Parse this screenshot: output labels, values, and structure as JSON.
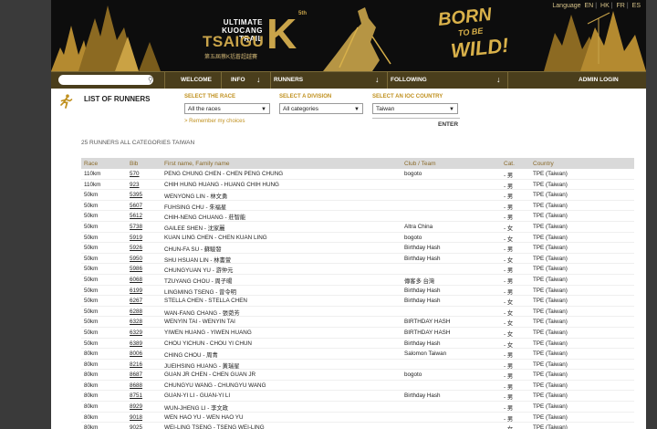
{
  "header": {
    "languages_label": "Language",
    "languages": [
      "EN",
      "HK",
      "FR",
      "ES"
    ],
    "logo_line1": "ULTIMATE",
    "logo_line2": "KUOCANG TRAIL",
    "logo_big": "TSAIGU",
    "logo_k": "K",
    "logo_edition": "5th",
    "logo_sub": "第五屆蔡K括蒼超越賽",
    "slogan": [
      "BORN",
      "TO BE",
      "WILD!"
    ]
  },
  "nav": {
    "search_placeholder": "",
    "items": [
      "WELCOME",
      "INFO",
      "RUNNERS",
      "FOLLOWING",
      "ADMIN LOGIN"
    ]
  },
  "filters": {
    "title": "LIST OF RUNNERS",
    "race_label": "SELECT THE RACE",
    "race_value": "All the races",
    "division_label": "SELECT A DIVISION",
    "division_value": "All categories",
    "country_label": "SELECT AN IOC COUNTRY",
    "country_value": "Taiwan",
    "remember": "> Remember my choices",
    "enter": "ENTER"
  },
  "summary": "25 RUNNERS ALL CATEGORIES TAIWAN",
  "table": {
    "columns": [
      "Race",
      "Bib",
      "First name, Family name",
      "Club / Team",
      "Cat.",
      "Country"
    ],
    "rows": [
      [
        "110km",
        "570",
        "PENG CHUNG CHEN - CHEN PENG CHUNG",
        "bogoto",
        "- 男",
        "TPE (Taiwan)"
      ],
      [
        "110km",
        "923",
        "CHIH HUNG HUANG - HUANG CHIH HUNG",
        "",
        "- 男",
        "TPE (Taiwan)"
      ],
      [
        "50km",
        "5395",
        "WENYONG LIN - 林文勇",
        "",
        "- 男",
        "TPE (Taiwan)"
      ],
      [
        "50km",
        "5607",
        "FUHSING CHU - 朱福星",
        "",
        "- 男",
        "TPE (Taiwan)"
      ],
      [
        "50km",
        "5612",
        "CHIH-NENG CHUANG - 莊智能",
        "",
        "- 男",
        "TPE (Taiwan)"
      ],
      [
        "50km",
        "5738",
        "GAILEE SHEN - 沈家麗",
        "Altra China",
        "- 女",
        "TPE (Taiwan)"
      ],
      [
        "50km",
        "5919",
        "KUAN LING CHEN - CHEN KUAN LING",
        "bogoto",
        "- 女",
        "TPE (Taiwan)"
      ],
      [
        "50km",
        "5926",
        "CHUN-FA SU - 蘇駿發",
        "Birthday Hash",
        "- 男",
        "TPE (Taiwan)"
      ],
      [
        "50km",
        "5950",
        "SHU HSUAN LIN - 林書萱",
        "Birthday Hash",
        "- 女",
        "TPE (Taiwan)"
      ],
      [
        "50km",
        "5986",
        "CHUNGYUAN YU - 游仲元",
        "",
        "- 男",
        "TPE (Taiwan)"
      ],
      [
        "50km",
        "6068",
        "TZUYANG CHOU - 周子暘",
        "傳客多 台灣",
        "- 男",
        "TPE (Taiwan)"
      ],
      [
        "50km",
        "6199",
        "LINGMING TSENG - 曾令明",
        "Birthday Hash",
        "- 男",
        "TPE (Taiwan)"
      ],
      [
        "50km",
        "6267",
        "STELLA CHEN - STELLA CHEN",
        "Birthday Hash",
        "- 女",
        "TPE (Taiwan)"
      ],
      [
        "50km",
        "6288",
        "WAN-FANG CHANG - 張菀芳",
        "",
        "- 女",
        "TPE (Taiwan)"
      ],
      [
        "50km",
        "6328",
        "WENYIN TAI - WENYIN TAI",
        "BIRTHDAY HASH",
        "- 女",
        "TPE (Taiwan)"
      ],
      [
        "50km",
        "6329",
        "YIWEN HUANG - YIWEN HUANG",
        "BIRTHDAY HASH",
        "- 女",
        "TPE (Taiwan)"
      ],
      [
        "50km",
        "6389",
        "CHOU YICHUN - CHOU YI CHUN",
        "Birthday Hash",
        "- 女",
        "TPE (Taiwan)"
      ],
      [
        "80km",
        "8006",
        "CHING CHOU - 周青",
        "Salomon Taiwan",
        "- 男",
        "TPE (Taiwan)"
      ],
      [
        "80km",
        "8216",
        "JUEIHSING HUANG - 黃瑞星",
        "",
        "- 男",
        "TPE (Taiwan)"
      ],
      [
        "80km",
        "8687",
        "GUAN JR CHEN - CHEN GUAN JR",
        "bogoto",
        "- 男",
        "TPE (Taiwan)"
      ],
      [
        "80km",
        "8688",
        "CHUNGYU WANG - CHUNGYU WANG",
        "",
        "- 男",
        "TPE (Taiwan)"
      ],
      [
        "80km",
        "8751",
        "GUAN-YI LI - GUAN-YI LI",
        "Birthday Hash",
        "- 男",
        "TPE (Taiwan)"
      ],
      [
        "80km",
        "8929",
        "WUN-JHENG LI - 李文政",
        "",
        "- 男",
        "TPE (Taiwan)"
      ],
      [
        "80km",
        "9018",
        "WEN HAO YU - WEN HAO YU",
        "",
        "- 男",
        "TPE (Taiwan)"
      ],
      [
        "80km",
        "9025",
        "WEI-LING TSENG - TSENG WEI-LING",
        "",
        "- 女",
        "TPE (Taiwan)"
      ]
    ]
  },
  "colors": {
    "gold": "#c9a44a",
    "nav_bg": "#4a3e1c",
    "header_row": "#d9d9d9",
    "label_gold": "#c0901e"
  }
}
